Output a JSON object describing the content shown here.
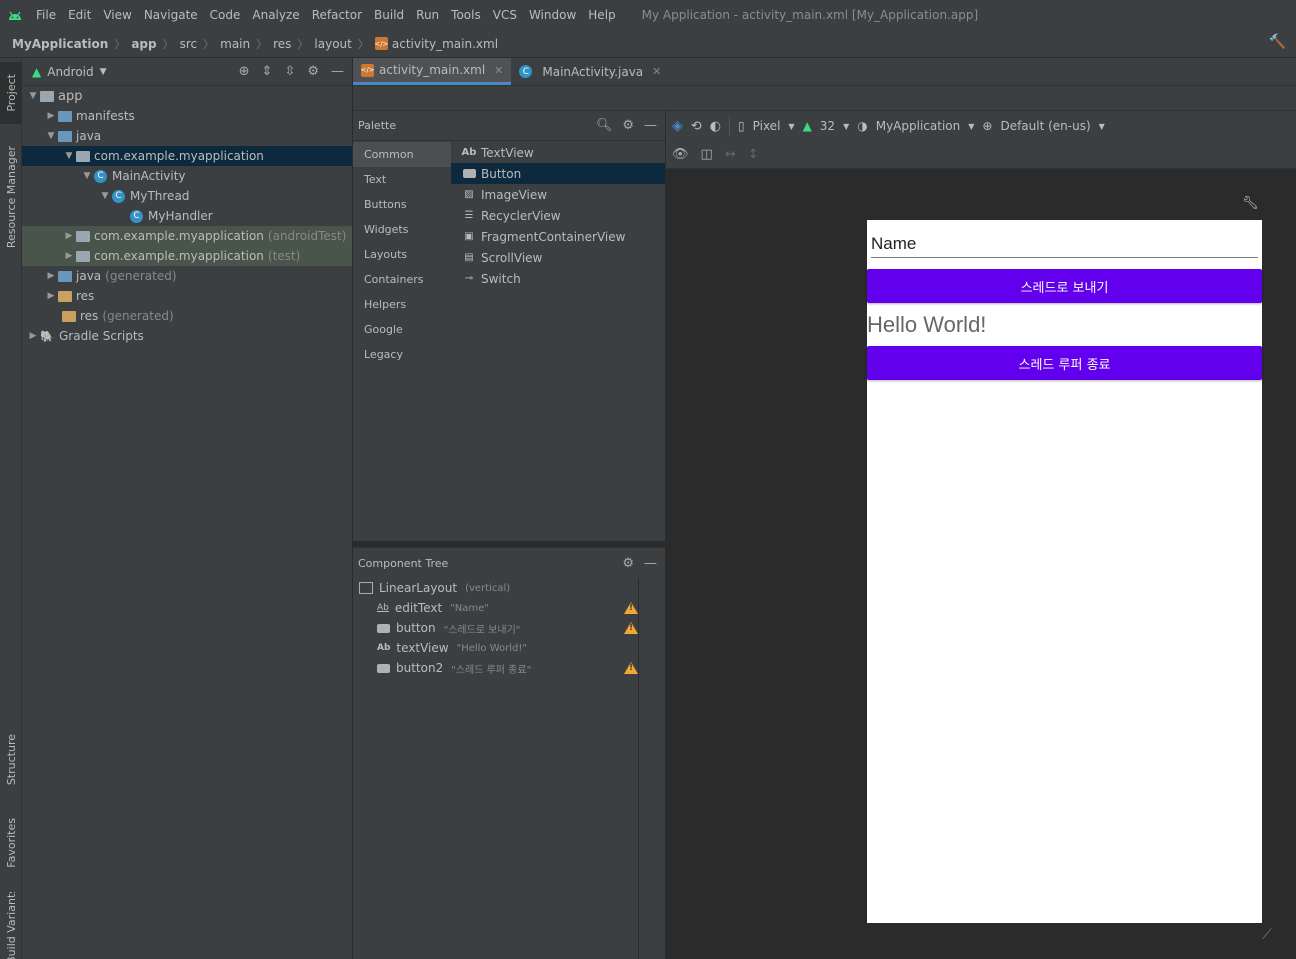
{
  "menubar": {
    "items": [
      "File",
      "Edit",
      "View",
      "Navigate",
      "Code",
      "Analyze",
      "Refactor",
      "Build",
      "Run",
      "Tools",
      "VCS",
      "Window",
      "Help"
    ],
    "window_title": "My Application - activity_main.xml [My_Application.app]"
  },
  "breadcrumb": [
    "MyApplication",
    "app",
    "src",
    "main",
    "res",
    "layout",
    "activity_main.xml"
  ],
  "left_stripe": {
    "project": "Project",
    "resource_manager": "Resource Manager",
    "structure": "Structure",
    "favorites": "Favorites",
    "build_variants": "Build Variants"
  },
  "project": {
    "view_mode": "Android",
    "tree": [
      {
        "label": "app",
        "extra": ""
      },
      {
        "label": "manifests",
        "extra": ""
      },
      {
        "label": "java",
        "extra": ""
      },
      {
        "label": "com.example.myapplication",
        "extra": ""
      },
      {
        "label": "MainActivity",
        "extra": ""
      },
      {
        "label": "MyThread",
        "extra": ""
      },
      {
        "label": "MyHandler",
        "extra": ""
      },
      {
        "label": "com.example.myapplication",
        "extra": "(androidTest)"
      },
      {
        "label": "com.example.myapplication",
        "extra": "(test)"
      },
      {
        "label": "java",
        "extra": "(generated)"
      },
      {
        "label": "res",
        "extra": ""
      },
      {
        "label": "res",
        "extra": "(generated)"
      },
      {
        "label": "Gradle Scripts",
        "extra": ""
      }
    ]
  },
  "editor_tabs": [
    {
      "label": "activity_main.xml",
      "active": true
    },
    {
      "label": "MainActivity.java",
      "active": false
    }
  ],
  "palette": {
    "title": "Palette",
    "categories": [
      "Common",
      "Text",
      "Buttons",
      "Widgets",
      "Layouts",
      "Containers",
      "Helpers",
      "Google",
      "Legacy"
    ],
    "items": [
      "TextView",
      "Button",
      "ImageView",
      "RecyclerView",
      "FragmentContainerView",
      "ScrollView",
      "Switch"
    ],
    "selected_category": "Common",
    "selected_item": "Button"
  },
  "component_tree": {
    "title": "Component Tree",
    "rows": [
      {
        "name": "LinearLayout",
        "hint": "(vertical)",
        "warning": false
      },
      {
        "name": "editText",
        "hint": "\"Name\"",
        "warning": true
      },
      {
        "name": "button",
        "hint": "\"스레드로 보내기\"",
        "warning": true
      },
      {
        "name": "textView",
        "hint": "\"Hello World!\"",
        "warning": false
      },
      {
        "name": "button2",
        "hint": "\"스레드 루퍼 종료\"",
        "warning": true
      }
    ]
  },
  "design_toolbar": {
    "device": "Pixel",
    "api": "32",
    "theme": "MyApplication",
    "locale": "Default (en-us)"
  },
  "preview": {
    "edit_text": "Name",
    "button1": "스레드로 보내기",
    "text_view": "Hello World!",
    "button2": "스레드 루퍼 종료",
    "button_color": "#6200ee"
  },
  "colors": {
    "accent": "#4a88c7",
    "selection": "#0d293e",
    "warning": "#f0a732",
    "android_green": "#3ddc84"
  }
}
